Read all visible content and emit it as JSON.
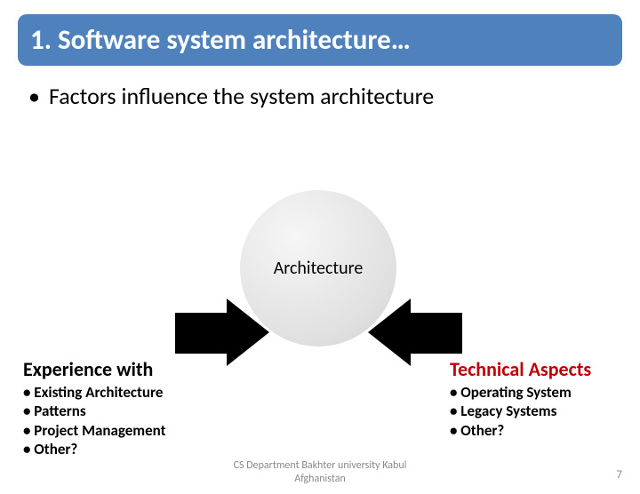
{
  "title": "1. Software system architecture…",
  "main_bullet": "Factors influence the system architecture",
  "circle_label": "Architecture",
  "left": {
    "heading": "Experience with",
    "items": [
      "• Existing Architecture",
      "• Patterns",
      "• Project Management",
      "• Other?"
    ]
  },
  "right": {
    "heading": "Technical Aspects",
    "items": [
      "• Operating System",
      "• Legacy Systems",
      "• Other?"
    ]
  },
  "footer_line1": "CS Department Bakhter university Kabul",
  "footer_line2": "Afghanistan",
  "slide_number": "7"
}
